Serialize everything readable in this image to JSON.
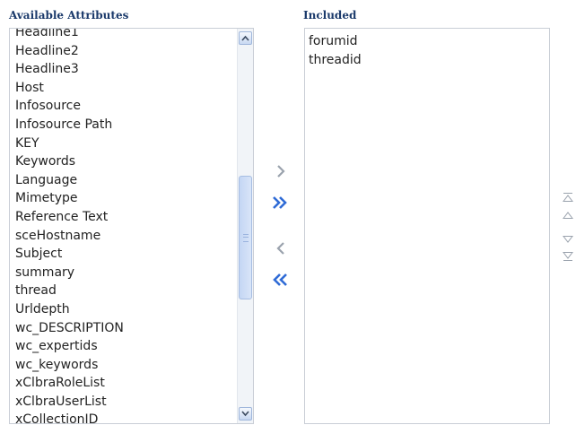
{
  "available": {
    "heading": "Available Attributes",
    "items": [
      "Headline1",
      "Headline2",
      "Headline3",
      "Host",
      "Infosource",
      "Infosource Path",
      "KEY",
      "Keywords",
      "Language",
      "Mimetype",
      "Reference Text",
      "sceHostname",
      "Subject",
      "summary",
      "thread",
      "Urldepth",
      "wc_DESCRIPTION",
      "wc_expertids",
      "wc_keywords",
      "xClbraRoleList",
      "xClbraUserList",
      "xCollectionID"
    ]
  },
  "included": {
    "heading": "Included",
    "items": [
      "forumid",
      "threadid"
    ]
  },
  "shuttle": {
    "move_icon": "chevron-right-icon",
    "move_all_icon": "double-chevron-right-icon",
    "remove_icon": "chevron-left-icon",
    "remove_all_icon": "double-chevron-left-icon"
  },
  "reorder": {
    "top_icon": "move-to-top-icon",
    "up_icon": "move-up-icon",
    "down_icon": "move-down-icon",
    "bottom_icon": "move-to-bottom-icon"
  },
  "colors": {
    "heading": "#1b3a6b",
    "active_arrow": "#2f6bd6",
    "disabled_arrow": "#9aa2ad",
    "list_border": "#c9ced6"
  }
}
